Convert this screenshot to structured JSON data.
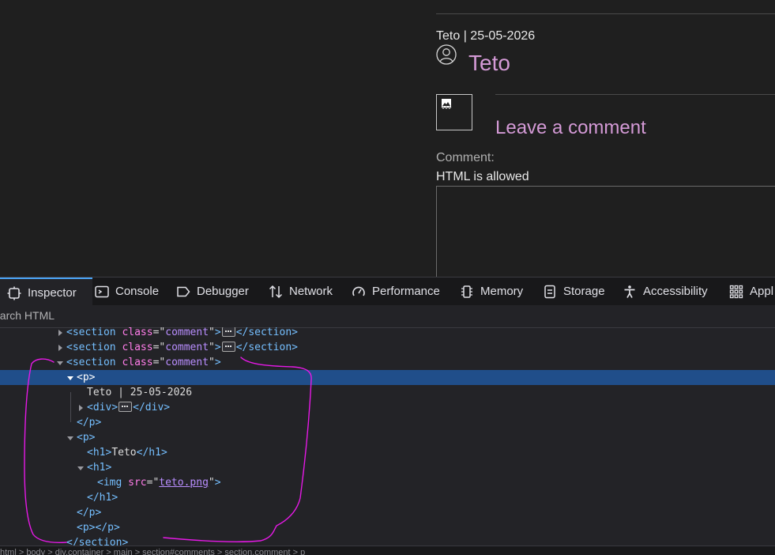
{
  "page": {
    "meta_line": "Teto | 25-05-2026",
    "author_name": "Teto",
    "leave_comment_heading": "Leave a comment",
    "comment_label": "Comment:",
    "html_note": "HTML is allowed",
    "comment_value": ""
  },
  "devtools": {
    "tabs": [
      {
        "label": "Inspector",
        "icon": "inspector-icon",
        "active": true
      },
      {
        "label": "Console",
        "icon": "console-icon"
      },
      {
        "label": "Debugger",
        "icon": "debugger-icon"
      },
      {
        "label": "Network",
        "icon": "network-icon"
      },
      {
        "label": "Performance",
        "icon": "performance-icon"
      },
      {
        "label": "Memory",
        "icon": "memory-icon"
      },
      {
        "label": "Storage",
        "icon": "storage-icon"
      },
      {
        "label": "Accessibility",
        "icon": "accessibility-icon"
      },
      {
        "label": "Appl",
        "icon": "application-icon"
      }
    ],
    "search_placeholder": "earch HTML",
    "tree": {
      "section_tag": "section",
      "class_attr": "class",
      "comment_value": "comment",
      "p_tag": "p",
      "text_node": "Teto | 25-05-2026",
      "div_tag": "div",
      "h1_tag": "h1",
      "h1_text": "Teto",
      "img_tag": "img",
      "src_attr": "src",
      "src_value": "teto.png"
    },
    "status_text": "html > body > div.container > main > section#comments > section.comment > p"
  },
  "colors": {
    "accent_pink": "#d49ad6",
    "selection_blue": "#204e8a",
    "tag_blue": "#75bfff",
    "attr_pink": "#ff7de9",
    "value_purple": "#b98eff",
    "annotation_magenta": "#e619e6"
  }
}
